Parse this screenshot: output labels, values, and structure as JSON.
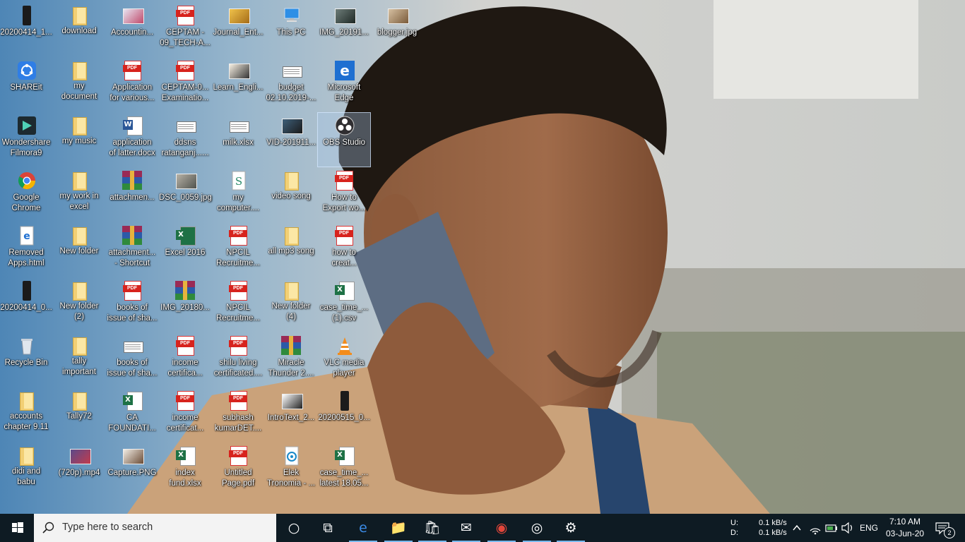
{
  "desktop_icons": [
    {
      "label": "20200414_1...",
      "type": "phone"
    },
    {
      "label": "download",
      "type": "folder"
    },
    {
      "label": "Accountin...",
      "type": "img",
      "c1": "#e8e4f1",
      "c2": "#c04a6b"
    },
    {
      "label": "CEPTAM -\n09_TECH-A...",
      "type": "pdf"
    },
    {
      "label": "Journal_Ent...",
      "type": "img",
      "c1": "#f0c24b",
      "c2": "#a56c17"
    },
    {
      "label": "This PC",
      "type": "thispc"
    },
    {
      "label": "IMG_20191...",
      "type": "img",
      "c1": "#6e7d79",
      "c2": "#1e2825"
    },
    {
      "label": "blogger.jpg",
      "type": "img",
      "c1": "#d6c0a2",
      "c2": "#7a5b3a"
    },
    {
      "label": "SHAREit",
      "type": "shareit"
    },
    {
      "label": "my\ndocument",
      "type": "folder"
    },
    {
      "label": "Application\nfor various...",
      "type": "pdf"
    },
    {
      "label": "CEPTAM-0...\nExaminatio...",
      "type": "pdf"
    },
    {
      "label": "Learn_Engli...",
      "type": "img",
      "c1": "#f6efe2",
      "c2": "#333333"
    },
    {
      "label": "budget\n02.10.2019-...",
      "type": "sheet"
    },
    {
      "label": "Microsoft\nEdge",
      "type": "edge"
    },
    {
      "label": "Wondershare\nFilmora9",
      "type": "filmora"
    },
    {
      "label": "my music",
      "type": "folder"
    },
    {
      "label": "application\nof latter.docx",
      "type": "doc"
    },
    {
      "label": "ddsns\nratanganj......",
      "type": "sheet"
    },
    {
      "label": "milk.xlsx",
      "type": "sheet"
    },
    {
      "label": "VID-201911...",
      "type": "img",
      "c1": "#3e5f79",
      "c2": "#1a1a1a"
    },
    {
      "label": "OBS Studio",
      "type": "obs"
    },
    {
      "label": "Google\nChrome",
      "type": "chrome"
    },
    {
      "label": "my work in\nexcel",
      "type": "folder"
    },
    {
      "label": "attachmen...",
      "type": "rar"
    },
    {
      "label": "DSC_0059.jpg",
      "type": "img",
      "c1": "#b7b2a6",
      "c2": "#51534e"
    },
    {
      "label": "my\ncomputer....",
      "type": "textfile"
    },
    {
      "label": "video song",
      "type": "folder"
    },
    {
      "label": "How to\nExport wo...",
      "type": "pdf"
    },
    {
      "label": "Removed\nApps.html",
      "type": "edgefile"
    },
    {
      "label": "New folder",
      "type": "folder"
    },
    {
      "label": "attachment...\n- Shortcut",
      "type": "rar"
    },
    {
      "label": "Excel 2016",
      "type": "excelapp"
    },
    {
      "label": "NPCIL\nRecruitme...",
      "type": "pdf"
    },
    {
      "label": "all mp3 song",
      "type": "folder"
    },
    {
      "label": "how to\ncreat...",
      "type": "pdf"
    },
    {
      "label": "20200414_0...",
      "type": "phone"
    },
    {
      "label": "New folder\n(2)",
      "type": "folder"
    },
    {
      "label": "books of\nissue of sha...",
      "type": "pdf"
    },
    {
      "label": "IMG_20180...",
      "type": "rar"
    },
    {
      "label": "NPCIL\nRecruitme...",
      "type": "pdf"
    },
    {
      "label": "New folder\n(4)",
      "type": "folder"
    },
    {
      "label": "case_time_...\n(1).csv",
      "type": "xlfile"
    },
    {
      "label": "Recycle Bin",
      "type": "recycle"
    },
    {
      "label": "tally\nimportant",
      "type": "folder"
    },
    {
      "label": "books of\nissue of sha...",
      "type": "sheet"
    },
    {
      "label": "income\ncertifica...",
      "type": "pdf"
    },
    {
      "label": "shilu living\ncertificated....",
      "type": "pdf"
    },
    {
      "label": "Miracle\nThunder 2....",
      "type": "rar"
    },
    {
      "label": "VLC media\nplayer",
      "type": "vlc"
    },
    {
      "label": "accounts\nchapter 9.11",
      "type": "folder"
    },
    {
      "label": "Tally72",
      "type": "folder"
    },
    {
      "label": "CA\nFOUNDATI...",
      "type": "xlfile"
    },
    {
      "label": "income\ncertificat...",
      "type": "pdf"
    },
    {
      "label": "subhash\nkumarDET....",
      "type": "pdf"
    },
    {
      "label": "IntroText_2...",
      "type": "img",
      "c1": "#ffffff",
      "c2": "#222222"
    },
    {
      "label": "20200515_0...",
      "type": "phone"
    },
    {
      "label": "didi and\nbabu",
      "type": "folder"
    },
    {
      "label": "(720p).mp4",
      "type": "img",
      "c1": "#5b4a8a",
      "c2": "#c23b4d"
    },
    {
      "label": "Capture.PNG",
      "type": "img",
      "c1": "#f1ece4",
      "c2": "#6b4c36"
    },
    {
      "label": "index\nfund.xlsx",
      "type": "xlfile"
    },
    {
      "label": "Untitled\nPage.pdf",
      "type": "pdf"
    },
    {
      "label": "Elek\nTronomia - ...",
      "type": "audio"
    },
    {
      "label": "case_time_...\nlatest 18.05...",
      "type": "xlfile"
    }
  ],
  "taskbar": {
    "search_placeholder": "Type here to search",
    "apps": [
      {
        "name": "cortana-icon",
        "glyph": "○"
      },
      {
        "name": "task-view-icon",
        "glyph": "⧉"
      },
      {
        "name": "edge-taskbar-icon",
        "glyph": "e"
      },
      {
        "name": "file-explorer-icon",
        "glyph": "📁"
      },
      {
        "name": "store-icon",
        "glyph": "🛍"
      },
      {
        "name": "mail-icon",
        "glyph": "✉"
      },
      {
        "name": "chrome-taskbar-icon",
        "glyph": "◉"
      },
      {
        "name": "groove-icon",
        "glyph": "◎"
      },
      {
        "name": "settings-icon",
        "glyph": "⚙"
      }
    ],
    "net_up_label": "U:",
    "net_down_label": "D:",
    "net_up": "0.1 kB/s",
    "net_down": "0.1 kB/s",
    "language": "ENG",
    "time": "7:10 AM",
    "date": "03-Jun-20",
    "notification_count": "2"
  }
}
